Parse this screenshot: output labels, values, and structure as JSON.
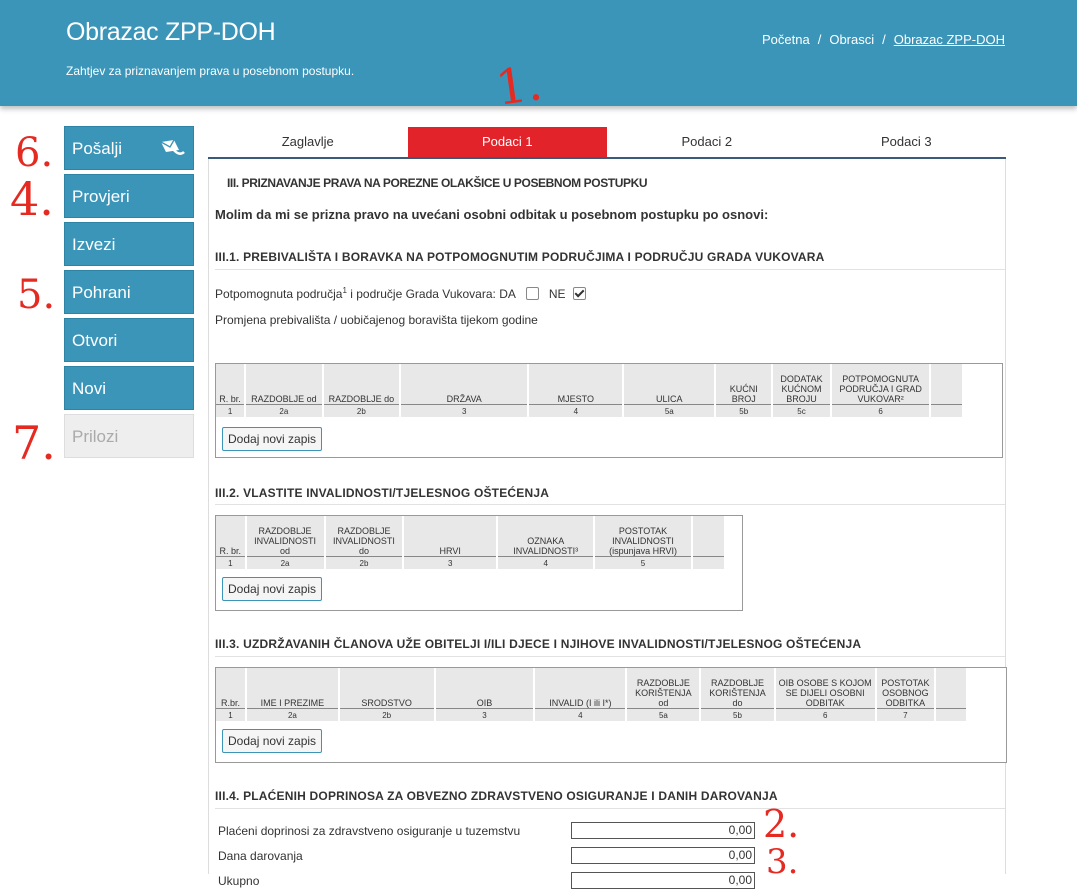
{
  "header": {
    "title": "Obrazac ZPP-DOH",
    "subtitle": "Zahtjev za priznavanjem prava u posebnom postupku.",
    "breadcrumbs": [
      "Početna",
      "Obrasci",
      "Obrazac ZPP-DOH"
    ],
    "separator": "/"
  },
  "sidebar": {
    "items": [
      {
        "label": "Pošalji",
        "icon": "send-mail-icon"
      },
      {
        "label": "Provjeri"
      },
      {
        "label": "Izvezi"
      },
      {
        "label": "Pohrani"
      },
      {
        "label": "Otvori"
      },
      {
        "label": "Novi"
      },
      {
        "label": "Prilozi",
        "disabled": true
      }
    ]
  },
  "tabs": [
    "Zaglavlje",
    "Podaci 1",
    "Podaci 2",
    "Podaci 3"
  ],
  "active_tab": "Podaci 1",
  "section": {
    "title": "III. PRIZNAVANJE PRAVA NA POREZNE OLAKŠICE U POSEBNOM POSTUPKU",
    "intro": "Molim da mi se prizna pravo na uvećani osobni odbitak u posebnom postupku po osnovi:"
  },
  "s1": {
    "title": "III.1. PREBIVALIŠTA I BORAVKA NA POTPOMOGNUTIM PODRUČJIMA I PODRUČJU GRADA VUKOVARA",
    "question_pre": "Potpomognuta područja",
    "question_sup": "1",
    "question_post": " i područje Grada Vukovara: DA",
    "no_label": "NE",
    "da_checked": false,
    "ne_checked": true,
    "table_caption": "Promjena prebivališta / uobičajenog boravišta tijekom godine",
    "columns": [
      "R. br.",
      "RAZDOBLJE od",
      "RAZDOBLJE do",
      "DRŽAVA",
      "MJESTO",
      "ULICA",
      "KUĆNI BROJ",
      "DODATAK KUĆNOM BROJU",
      "POTPOMOGNUTA PODRUČJA I GRAD VUKOVAR²"
    ],
    "col_numbers": [
      "1",
      "2a",
      "2b",
      "3",
      "4",
      "5a",
      "5b",
      "5c",
      "6"
    ],
    "add_button": "Dodaj novi zapis"
  },
  "s2": {
    "title": "III.2. VLASTITE INVALIDNOSTI/TJELESNOG OŠTEĆENJA",
    "columns": [
      "R. br.",
      "RAZDOBLJE INVALIDNOSTI od",
      "RAZDOBLJE INVALIDNOSTI do",
      "HRVI",
      "OZNAKA INVALIDNOSTI³",
      "POSTOTAK INVALIDNOSTI (ispunjava HRVI)"
    ],
    "col_numbers": [
      "1",
      "2a",
      "2b",
      "3",
      "4",
      "5"
    ],
    "add_button": "Dodaj novi zapis"
  },
  "s3": {
    "title": "III.3. UZDRŽAVANIH ČLANOVA UŽE OBITELJI I/ILI DJECE I NJIHOVE INVALIDNOSTI/TJELESNOG OŠTEĆENJA",
    "columns": [
      "R.br.",
      "IME I PREZIME",
      "SRODSTVO",
      "OIB",
      "INVALID (I ili I*)",
      "RAZDOBLJE KORIŠTENJA od",
      "RAZDOBLJE KORIŠTENJA do",
      "OIB OSOBE S KOJOM SE DIJELI OSOBNI ODBITAK",
      "POSTOTAK OSOBNOG ODBITKA"
    ],
    "col_numbers": [
      "1",
      "2a",
      "2b",
      "3",
      "4",
      "5a",
      "5b",
      "6",
      "7"
    ],
    "add_button": "Dodaj novi zapis"
  },
  "s4": {
    "title": "III.4. PLAĆENIH DOPRINOSA ZA OBVEZNO ZDRAVSTVENO OSIGURANJE I DANIH DAROVANJA",
    "rows": [
      {
        "label": "Plaćeni doprinosi za zdravstveno osiguranje u tuzemstvu",
        "value": "0,00"
      },
      {
        "label": "Dana darovanja",
        "value": "0,00"
      },
      {
        "label": "Ukupno",
        "value": "0,00"
      }
    ]
  },
  "annotations": [
    "1.",
    "2.",
    "3.",
    "4.",
    "5.",
    "6.",
    "7."
  ],
  "colors": {
    "header_bg": "#3b95b8",
    "active_tab": "#e2232a",
    "annotation": "#e52a22"
  }
}
